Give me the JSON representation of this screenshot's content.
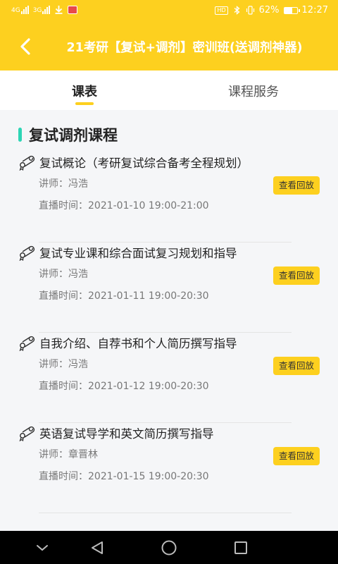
{
  "status_bar": {
    "signal_1_label": "4G",
    "signal_2_label": "3G",
    "battery_percent": "62%",
    "time": "12:27",
    "hd_label": "HD",
    "battery_level": 0.62
  },
  "app_bar": {
    "title": "21考研【复试+调剂】密训班(送调剂神器)"
  },
  "tabs": [
    {
      "label": "课表",
      "active": true
    },
    {
      "label": "课程服务",
      "active": false
    }
  ],
  "section": {
    "title": "复试调剂课程",
    "accent_color": "#2dd5b5"
  },
  "courses": [
    {
      "title": "复试概论（考研复试综合备考全程规划）",
      "teacher": "讲师：冯浩",
      "time": "直播时间：2021-01-10 19:00-21:00",
      "button": "查看回放"
    },
    {
      "title": "复试专业课和综合面试复习规划和指导",
      "teacher": "讲师：冯浩",
      "time": "直播时间：2021-01-11 19:00-20:30",
      "button": "查看回放"
    },
    {
      "title": "自我介绍、自荐书和个人简历撰写指导",
      "teacher": "讲师：冯浩",
      "time": "直播时间：2021-01-12 19:00-20:30",
      "button": "查看回放"
    },
    {
      "title": "英语复试导学和英文简历撰写指导",
      "teacher": "讲师：章晋林",
      "time": "直播时间：2021-01-15 19:00-20:30",
      "button": "查看回放"
    }
  ],
  "colors": {
    "brand": "#fdd01f",
    "accent": "#2dd5b5"
  },
  "icons": {
    "back": "chevron-left-icon",
    "course": "diploma-icon",
    "nav_down": "chevron-down-icon",
    "nav_back": "triangle-back-icon",
    "nav_home": "circle-home-icon",
    "nav_recent": "square-recent-icon"
  }
}
